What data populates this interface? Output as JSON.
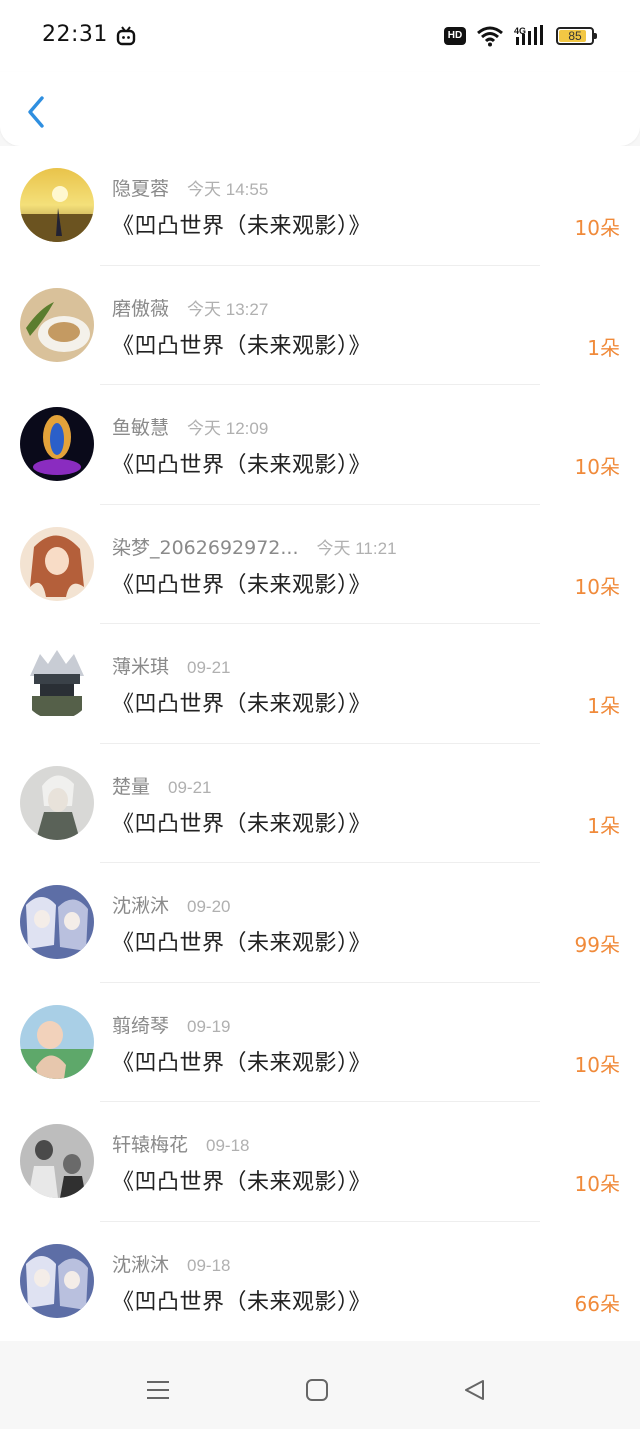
{
  "status_bar": {
    "time": "22:31",
    "battery": "85"
  },
  "nav": {
    "back_icon": "back-chevron-icon"
  },
  "items": [
    {
      "name": "隐夏蓉",
      "date": "今天 14:55",
      "title": "《凹凸世界（未来观影）》",
      "count": "10朵"
    },
    {
      "name": "磨傲薇",
      "date": "今天 13:27",
      "title": "《凹凸世界（未来观影）》",
      "count": "1朵"
    },
    {
      "name": "鱼敏慧",
      "date": "今天 12:09",
      "title": "《凹凸世界（未来观影）》",
      "count": "10朵"
    },
    {
      "name": "染梦_2062692972...",
      "date": "今天 11:21",
      "title": "《凹凸世界（未来观影）》",
      "count": "10朵"
    },
    {
      "name": "薄米琪",
      "date": "09-21",
      "title": "《凹凸世界（未来观影）》",
      "count": "1朵"
    },
    {
      "name": "楚量",
      "date": "09-21",
      "title": "《凹凸世界（未来观影）》",
      "count": "1朵"
    },
    {
      "name": "沈湫沐",
      "date": "09-20",
      "title": "《凹凸世界（未来观影）》",
      "count": "99朵"
    },
    {
      "name": "翦绮琴",
      "date": "09-19",
      "title": "《凹凸世界（未来观影）》",
      "count": "10朵"
    },
    {
      "name": "轩辕梅花",
      "date": "09-18",
      "title": "《凹凸世界（未来观影）》",
      "count": "10朵"
    },
    {
      "name": "沈湫沐",
      "date": "09-18",
      "title": "《凹凸世界（未来观影）》",
      "count": "66朵"
    }
  ],
  "colors": {
    "accent_count": "#f08a3a",
    "back_icon": "#2f8fe0"
  }
}
